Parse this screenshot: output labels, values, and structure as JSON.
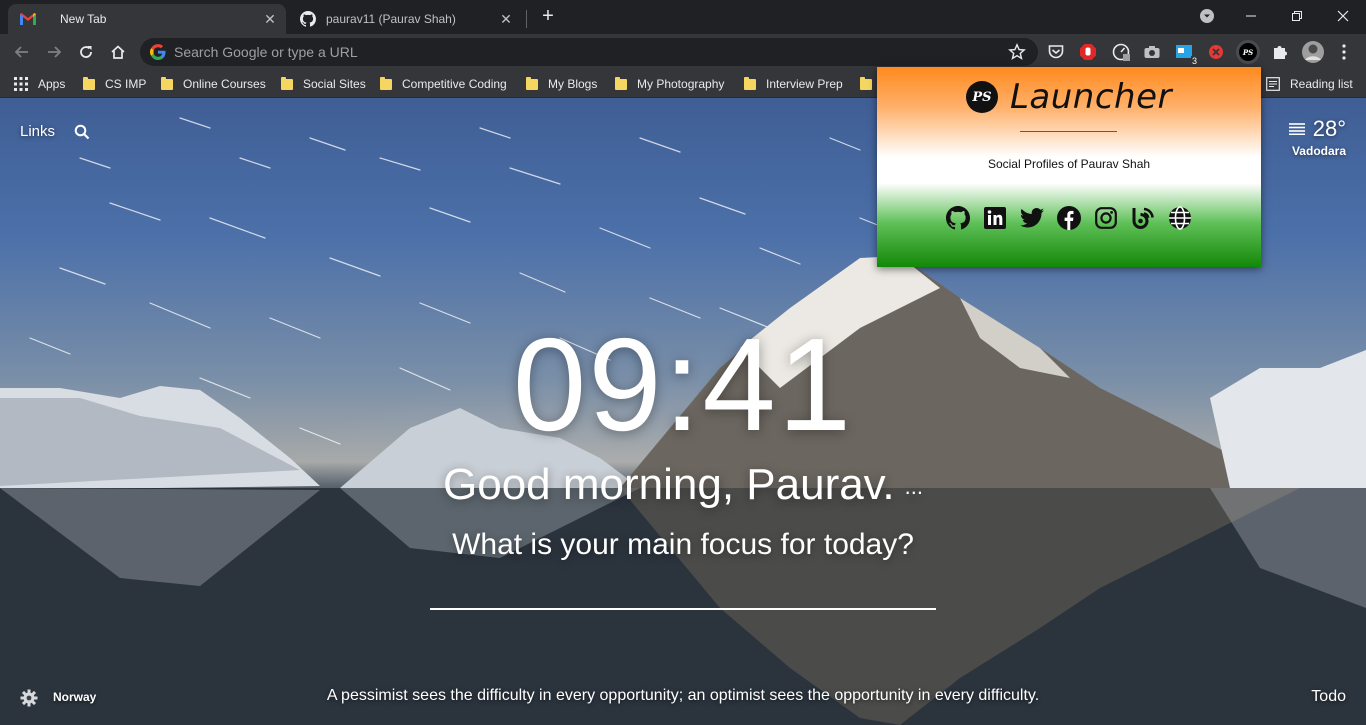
{
  "browser": {
    "tabs": [
      {
        "title": "New Tab",
        "favicon": "gmail-icon"
      },
      {
        "title": "paurav11 (Paurav Shah)",
        "favicon": "github-icon"
      }
    ],
    "omnibox_placeholder": "Search Google or type a URL",
    "extension_badge": "3",
    "bookmarks": {
      "apps_label": "Apps",
      "items": [
        "CS IMP",
        "Online Courses",
        "Social Sites",
        "Competitive Coding",
        "My Blogs",
        "My Photography",
        "Interview Prep"
      ],
      "reading_list": "Reading list"
    },
    "colors": {
      "tab_strip": "#202124",
      "toolbar": "#35363a",
      "folder": "#f5d660"
    }
  },
  "momentum": {
    "links_label": "Links",
    "weather": {
      "temp": "28°",
      "city": "Vadodara"
    },
    "clock": "09:41",
    "greeting": "Good morning, Paurav.",
    "greeting_more": "...",
    "focus_question": "What is your main focus for today?",
    "location": "Norway",
    "quote": "A pessimist sees the difficulty in every opportunity; an optimist sees the opportunity in every difficulty.",
    "todo_label": "Todo"
  },
  "popup": {
    "logo_text": "PS",
    "title": "Launcher",
    "subtitle": "Social Profiles of Paurav Shah",
    "socials": [
      "github-icon",
      "linkedin-icon",
      "twitter-icon",
      "facebook-icon",
      "instagram-icon",
      "blog-icon",
      "globe-icon"
    ],
    "colors": {
      "saffron": "#ff8a1e",
      "white": "#ffffff",
      "green": "#138808"
    }
  }
}
